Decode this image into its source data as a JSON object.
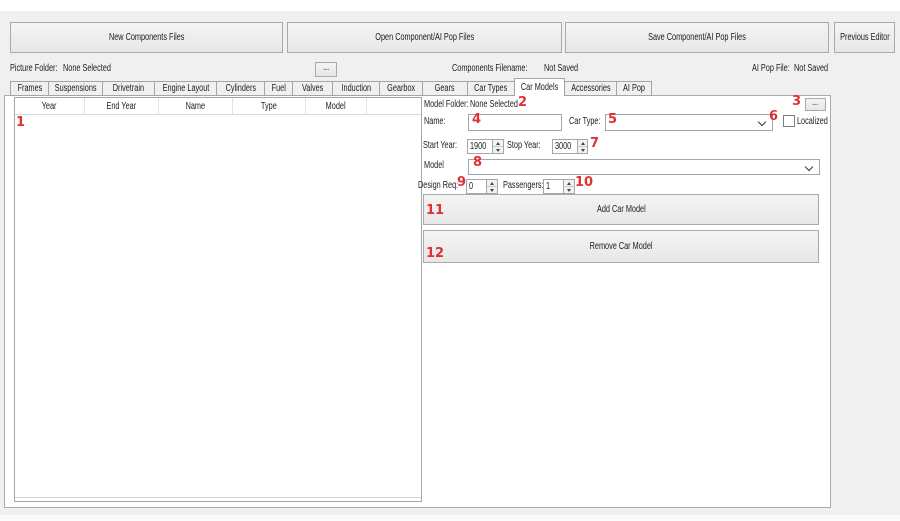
{
  "toolbar": {
    "new_button": "New Components Files",
    "open_button": "Open Component/AI Pop Files",
    "save_button": "Save Component/AI Pop Files",
    "previous_button": "Previous Editor"
  },
  "status_bar": {
    "picture_folder_label": "Picture Folder:",
    "picture_folder_value": "None Selected",
    "browse_button": "...",
    "components_filename_label": "Components Filename:",
    "components_filename_value": "Not Saved",
    "ai_pop_file_label": "AI Pop File:",
    "ai_pop_file_value": "Not Saved"
  },
  "tabs": {
    "selected": "Car Models",
    "items": [
      {
        "label": "Frames"
      },
      {
        "label": "Suspensions"
      },
      {
        "label": "Drivetrain"
      },
      {
        "label": "Engine Layout"
      },
      {
        "label": "Cylinders"
      },
      {
        "label": "Fuel"
      },
      {
        "label": "Valves"
      },
      {
        "label": "Induction"
      },
      {
        "label": "Gearbox"
      },
      {
        "label": "Gears"
      },
      {
        "label": "Car Types"
      },
      {
        "label": "Car Models"
      },
      {
        "label": "Accessories"
      },
      {
        "label": "AI Pop"
      }
    ]
  },
  "car_models": {
    "list_columns": [
      "Year",
      "End Year",
      "Name",
      "Type",
      "Model",
      ""
    ],
    "model_folder_label": "Model Folder:",
    "model_folder_value": "None Selected",
    "browse_button": "...",
    "name_label": "Name:",
    "name_value": "",
    "car_type_label": "Car Type:",
    "car_type_value": "",
    "localized_label": "Localized",
    "localized_checked": false,
    "start_year_label": "Start Year:",
    "start_year_value": "1900",
    "stop_year_label": "Stop Year:",
    "stop_year_value": "3000",
    "model_label": "Model",
    "model_value": "",
    "design_req_label": "Design Req:",
    "design_req_value": "0",
    "passengers_label": "Passengers:",
    "passengers_value": "1",
    "add_button": "Add Car Model",
    "remove_button": "Remove Car Model"
  },
  "annotations": {
    "color": "#e03131",
    "labels": [
      "1",
      "2",
      "3",
      "4",
      "5",
      "6",
      "7",
      "8",
      "9",
      "10",
      "11",
      "12"
    ]
  }
}
